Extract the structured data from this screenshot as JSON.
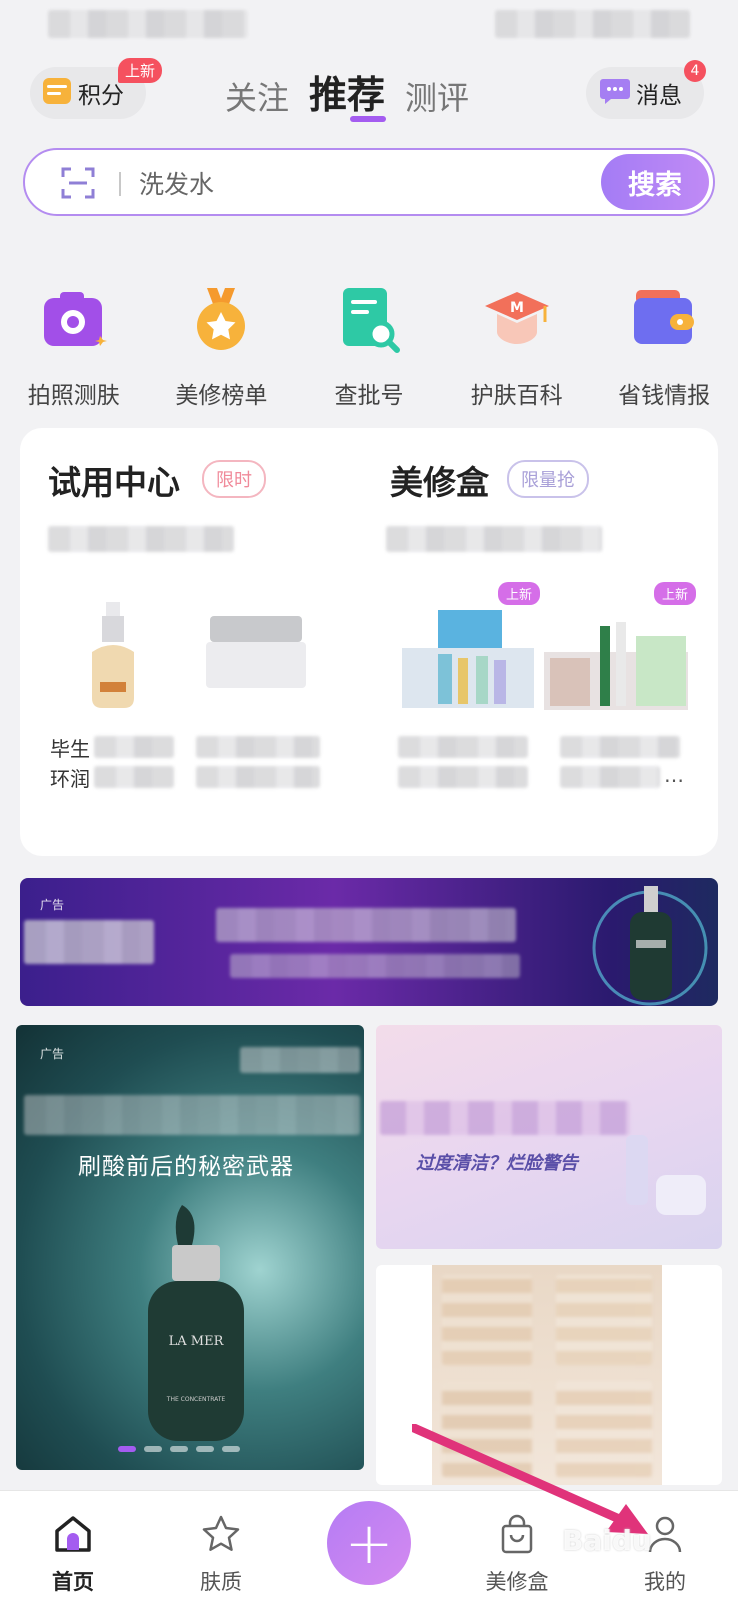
{
  "header": {
    "points_label": "积分",
    "points_badge": "上新",
    "tabs": [
      {
        "label": "关注"
      },
      {
        "label": "推荐"
      },
      {
        "label": "测评"
      }
    ],
    "message_label": "消息",
    "message_count": "4"
  },
  "search": {
    "placeholder": "洗发水",
    "button_label": "搜索"
  },
  "quick_tiles": [
    {
      "label": "拍照测肤",
      "icon": "camera-icon"
    },
    {
      "label": "美修榜单",
      "icon": "medal-icon"
    },
    {
      "label": "查批号",
      "icon": "document-search-icon"
    },
    {
      "label": "护肤百科",
      "icon": "graduation-cap-icon"
    },
    {
      "label": "省钱情报",
      "icon": "wallet-icon"
    }
  ],
  "trial_center": {
    "title": "试用中心",
    "tag": "限时",
    "items": [
      {
        "name_line1": "毕生",
        "name_line2": "环润"
      },
      {
        "name_line1": "",
        "name_line2": ""
      }
    ]
  },
  "beauty_box": {
    "title": "美修盒",
    "tag": "限量抢",
    "new_badge": "上新",
    "items": [
      {
        "name_line1": "",
        "name_line2": ""
      },
      {
        "name_line1": "",
        "name_line2": "…"
      }
    ]
  },
  "ads": {
    "wide_label": "广告",
    "left_label": "广告",
    "left_text": "刷酸前后的秘密武器",
    "left_brand": "LA MER",
    "left_caption": "THE CONCENTRATE",
    "right_text": "过度清洁？烂脸警告"
  },
  "bottom_nav": [
    {
      "label": "首页",
      "icon": "home-icon"
    },
    {
      "label": "肤质",
      "icon": "star-icon"
    },
    {
      "label": "美修盒",
      "icon": "shopping-bag-icon"
    },
    {
      "label": "我的",
      "icon": "user-icon"
    }
  ],
  "watermark": "Baidu"
}
